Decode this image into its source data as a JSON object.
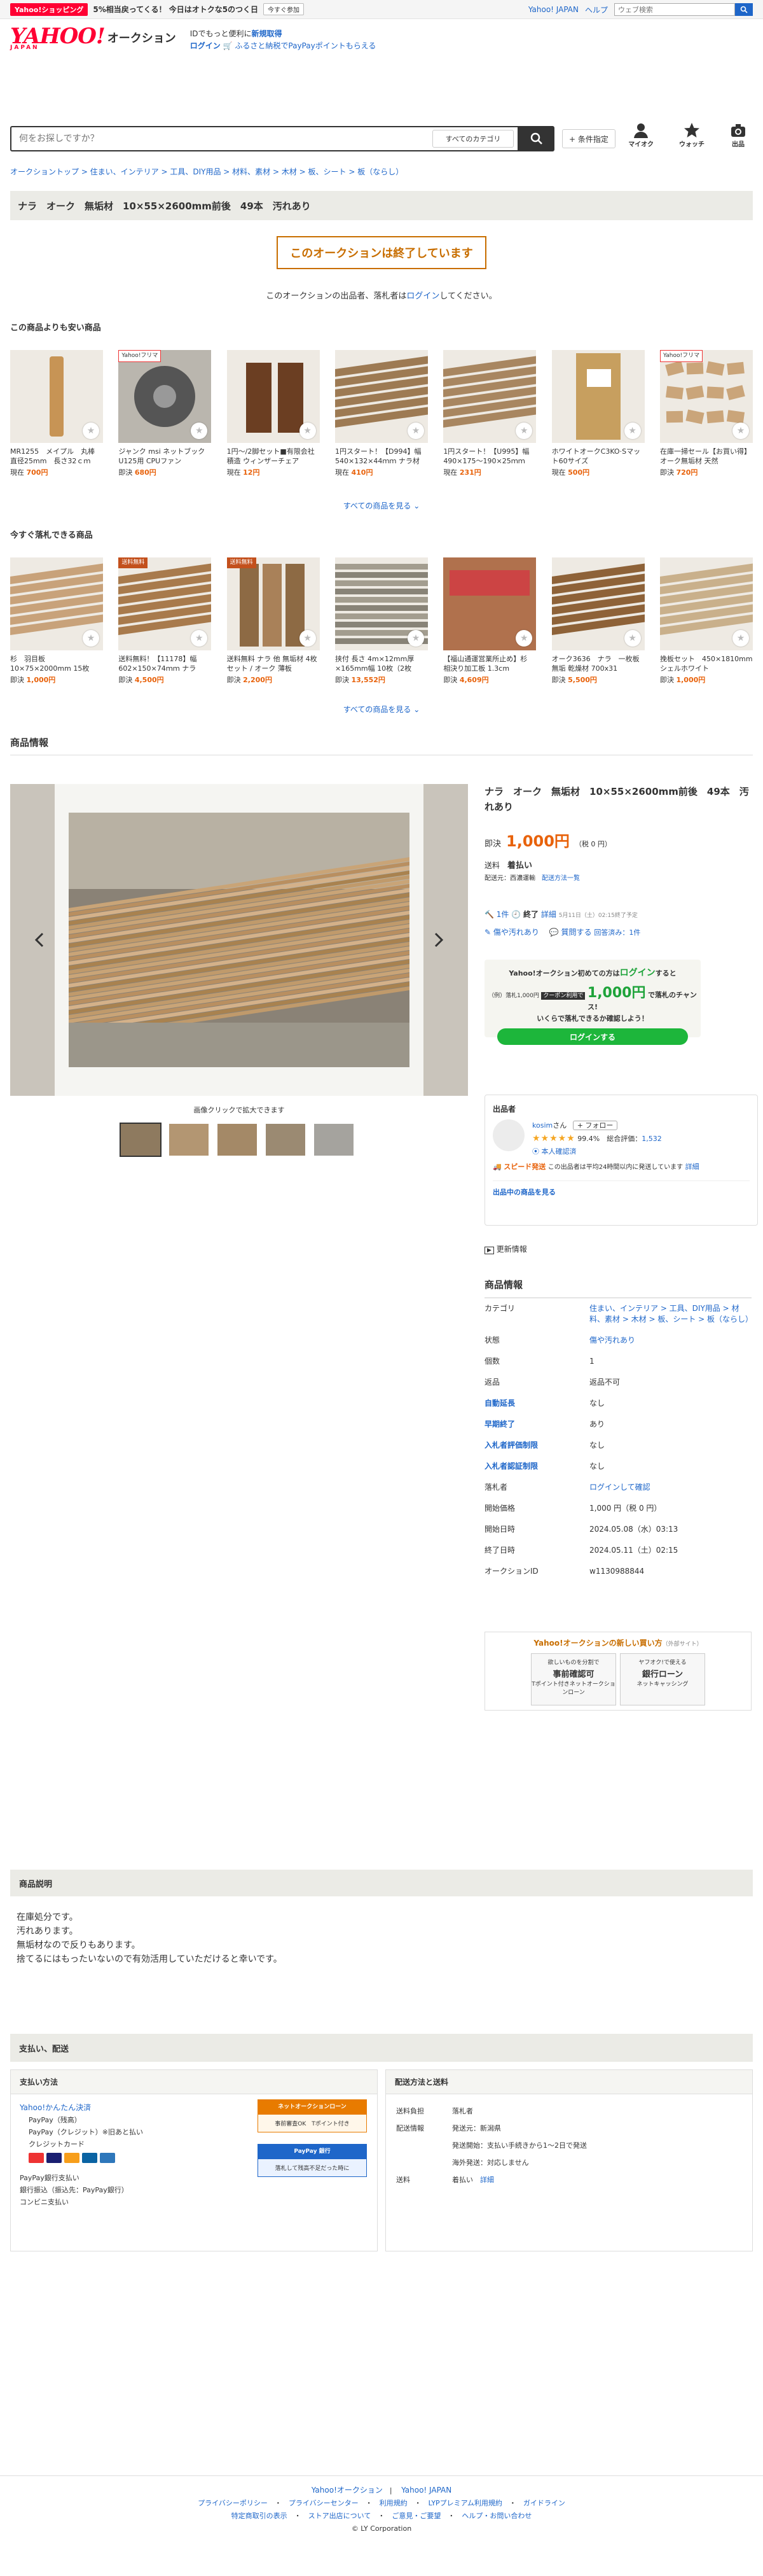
{
  "topstrip": {
    "shop_badge": "Yahoo!ショッピング",
    "promo_text": "5%相当戻ってくる！ 今日はオトクな5のつく日",
    "promo_button": "今すぐ参加",
    "links": [
      "Yahoo! JAPAN",
      "ヘルプ"
    ],
    "search_placeholder": "ウェブ検索"
  },
  "header": {
    "logo_main": "YAHOO!",
    "logo_sub": "JAPAN",
    "logo_service": "オークション",
    "id_line_prefix": "IDでもっと便利に",
    "id_line_link": "新規取得",
    "login_link": "ログイン",
    "furusato": "ふるさと納税でPayPayポイントもらえる"
  },
  "search": {
    "placeholder": "何をお探しですか？",
    "category": "すべてのカテゴリ",
    "condition_button": "+ 条件指定",
    "nav": [
      {
        "label": "マイオク",
        "icon": "person-icon"
      },
      {
        "label": "ウォッチ",
        "icon": "star-icon"
      },
      {
        "label": "出品",
        "icon": "camera-icon"
      }
    ]
  },
  "breadcrumb": "オークショントップ > 住まい、インテリア > 工具、DIY用品 > 材料、素材 > 木材 > 板、シート > 板（ならし）",
  "item_title": "ナラ　オーク　無垢材　10×55×2600mm前後　49本　汚れあり",
  "ended": {
    "label": "このオークションは終了しています",
    "note_prefix": "このオークションの出品者、落札者は",
    "note_link": "ログイン",
    "note_suffix": "してください。"
  },
  "cheaper": {
    "title": "この商品よりも安い商品",
    "see_all": "すべての商品を見る",
    "items": [
      {
        "tag": "",
        "title": "MR1255　メイプル　丸棒　直径25mm　長さ32ｃｍ",
        "price_label": "現在",
        "price": "700円",
        "color": "#c79455",
        "img": "dowel"
      },
      {
        "tag": "Yahoo!フリマ",
        "title": "ジャンク msi ネットブックU125用 CPUファン",
        "price_label": "即決",
        "price": "680円",
        "color": "#9d9a94",
        "img": "fan"
      },
      {
        "tag": "",
        "title": "1円〜/2脚セット■有限会社 積造 ウィンザーチェア",
        "price_label": "現在",
        "price": "12円",
        "color": "#6b3e22",
        "img": "chair"
      },
      {
        "tag": "",
        "title": "1円スタート！【D994】幅 540×132×44ｍｍ ナラ材",
        "price_label": "現在",
        "price": "410円",
        "color": "#9d7a53",
        "img": "plank"
      },
      {
        "tag": "",
        "title": "1円スタート！【U995】幅 490×175〜190×25ｍｍ",
        "price_label": "現在",
        "price": "231円",
        "color": "#a88660",
        "img": "plank2"
      },
      {
        "tag": "",
        "title": "ホワイトオークC3KO·Sマット60サイズ",
        "price_label": "現在",
        "price": "500円",
        "color": "#c79f5f",
        "img": "board"
      },
      {
        "tag": "Yahoo!フリマ",
        "title": "在庫一掃セール【お買い得】オーク無垢材 天然",
        "price_label": "即決",
        "price": "720円",
        "color": "#caa57a",
        "img": "blocks"
      }
    ]
  },
  "buynow_section": {
    "title": "今すぐ落札できる商品",
    "see_all": "すべての商品を見る",
    "items": [
      {
        "tag": "",
        "title": "杉　羽目板　10×75×2000mm 15枚",
        "price_label": "即決",
        "price": "1,000円",
        "color": "#c8a27a",
        "img": "slats"
      },
      {
        "tag": "送料無料",
        "title": "送料無料！【11178】幅602×150×74ｍｍ ナラ",
        "price_label": "即決",
        "price": "4,500円",
        "color": "#a87a4c",
        "img": "slab"
      },
      {
        "tag": "送料無料",
        "title": "送料無料 ナラ 他 無垢材 4枚セット / オーク 薄板",
        "price_label": "即決",
        "price": "2,200円",
        "color": "#8d6a44",
        "img": "posts"
      },
      {
        "tag": "",
        "title": "挟付 長さ 4m×12mm厚×165mm幅 10枚（2枚",
        "price_label": "即決",
        "price": "13,552円",
        "color": "#7c7669",
        "img": "stack"
      },
      {
        "tag": "",
        "title": "【福山通運営業所止め】杉 相決り加工板 1.3cm",
        "price_label": "即決",
        "price": "4,609円",
        "color": "#b0714d",
        "img": "redwood"
      },
      {
        "tag": "",
        "title": "オーク3636　ナラ　一枚板無垢 乾燥材 700x31",
        "price_label": "即決",
        "price": "5,500円",
        "color": "#8e6238",
        "img": "slab2"
      },
      {
        "tag": "",
        "title": "挽板セット　450×1810mm シェルホワイト",
        "price_label": "即決",
        "price": "1,000円",
        "color": "#c9b08b",
        "img": "planks3"
      }
    ]
  },
  "product_info_heading": "商品情報",
  "gallery": {
    "zoom_note": "画像クリックで拡大できます",
    "thumbs": 5
  },
  "detail": {
    "title": "ナラ　オーク　無垢材　10×55×2600mm前後　49本　汚れあり",
    "buynow_label": "即決",
    "buynow_price": "1,000円",
    "tax": "（税 0 円）",
    "ship_label": "送料",
    "ship_value": "着払い",
    "ship_from_prefix": "配送元：",
    "ship_from": "西濃運輸",
    "ship_link": "配送方法一覧",
    "bids": "1件",
    "bids_link": "詳細",
    "status_end": "終了",
    "status_end_note": "5月11日（土）02:15終了予定",
    "condition": "傷や汚れあり",
    "question": "質問する",
    "answers": "回答済み：1件"
  },
  "loginbox": {
    "line1": "Yahoo!オークション初めての方は",
    "login": "ログイン",
    "line1b": "すると",
    "line2a": "（例）落札1,000円",
    "coupon": "クーポン利用で",
    "big": "1,000円",
    "line2b": "で落札のチャンス!",
    "line3": "いくらで落札できるか確認しよう！",
    "button": "ログインする"
  },
  "seller": {
    "heading": "出品者",
    "name": "kosim",
    "name_suffix": "さん",
    "follow": "+ フォロー",
    "rating_pct": "99.4%",
    "total_label": "総合評価：",
    "total": "1,532",
    "verified": "本人確認済",
    "badge": "スピード発送",
    "speed_note": "この出品者は平均24時間以内に発送しています",
    "detail_link": "詳細",
    "listings_link": "出品中の商品を見る"
  },
  "update_info": "更新情報",
  "info_table": {
    "heading": "商品情報",
    "rows": [
      {
        "k": "カテゴリ",
        "v": "住まい、インテリア > 工具、DIY用品 > 材料、素材 > 木材 > 板、シート > 板（ならし）",
        "blue_k": false,
        "blue_v": true
      },
      {
        "k": "状態",
        "v": "傷や汚れあり",
        "blue_k": false,
        "blue_v": true
      },
      {
        "k": "個数",
        "v": "1",
        "blue_k": false,
        "blue_v": false
      },
      {
        "k": "返品",
        "v": "返品不可",
        "blue_k": false,
        "blue_v": false
      },
      {
        "k": "自動延長",
        "v": "なし",
        "blue_k": true,
        "blue_v": false
      },
      {
        "k": "早期終了",
        "v": "あり",
        "blue_k": true,
        "blue_v": false
      },
      {
        "k": "入札者評価制限",
        "v": "なし",
        "blue_k": true,
        "blue_v": false
      },
      {
        "k": "入札者認証制限",
        "v": "なし",
        "blue_k": true,
        "blue_v": false
      },
      {
        "k": "落札者",
        "v": "ログインして確認",
        "blue_k": false,
        "blue_v": true
      },
      {
        "k": "開始価格",
        "v": "1,000 円（税 0 円）",
        "blue_k": false,
        "blue_v": false
      },
      {
        "k": "開始日時",
        "v": "2024.05.08（水）03:13",
        "blue_k": false,
        "blue_v": false
      },
      {
        "k": "終了日時",
        "v": "2024.05.11（土）02:15",
        "blue_k": false,
        "blue_v": false
      },
      {
        "k": "オークションID",
        "v": "w1130988844",
        "blue_k": false,
        "blue_v": false
      }
    ]
  },
  "newbuy": {
    "title": "Yahoo!オークションの新しい買い方",
    "small": "（外部サイト）",
    "card1_top": "欲しいものを分割で",
    "card1_main": "事前確認可",
    "card1_sub": "Tポイント付きネットオークションローン",
    "card2_top": "ヤフオク!で使える",
    "card2_main": "銀行ローン",
    "card2_sub": "ネットキャッシング"
  },
  "description": {
    "heading": "商品説明",
    "lines": [
      "在庫処分です。",
      "汚れあります。",
      "無垢材なので反りもあります。",
      "捨てるにはもったいないので有効活用していただけると幸いです。"
    ]
  },
  "payship": {
    "heading": "支払い、配送",
    "pay_heading": "支払い方法",
    "pay_link": "Yahoo!かんたん決済",
    "pay_items": [
      "PayPay（残高）",
      "PayPay（クレジット）※旧あと払い",
      "クレジットカード"
    ],
    "pay_items2": [
      "PayPay銀行支払い",
      "銀行振込（振込先：PayPay銀行）",
      "コンビニ支払い"
    ],
    "ad1_title": "ネットオークションローン",
    "ad1_sub": "事前審査OK　Tポイント付き",
    "ad2_title": "落札して残高不足だった時に",
    "ad2_sub": "PayPay 銀行",
    "ship_heading": "配送方法と送料",
    "ship_rows": [
      {
        "k": "送料負担",
        "v": "落札者"
      },
      {
        "k": "配送情報",
        "v": "発送元：新潟県"
      },
      {
        "k": "",
        "v": "発送開始：支払い手続きから1〜2日で発送"
      },
      {
        "k": "",
        "v": "海外発送：対応しません"
      },
      {
        "k": "送料",
        "v": "着払い"
      }
    ],
    "ship_detail_link": "詳細"
  },
  "footer": {
    "top_links": [
      "Yahoo!オークション",
      "Yahoo! JAPAN"
    ],
    "links1": [
      "プライバシーポリシー",
      "プライバシーセンター",
      "利用規約",
      "LYPプレミアム利用規約",
      "ガイドライン"
    ],
    "links2": [
      "特定商取引の表示",
      "ストア出店について",
      "ご意見・ご要望",
      "ヘルプ・お問い合わせ"
    ],
    "copyright": "© LY Corporation"
  }
}
